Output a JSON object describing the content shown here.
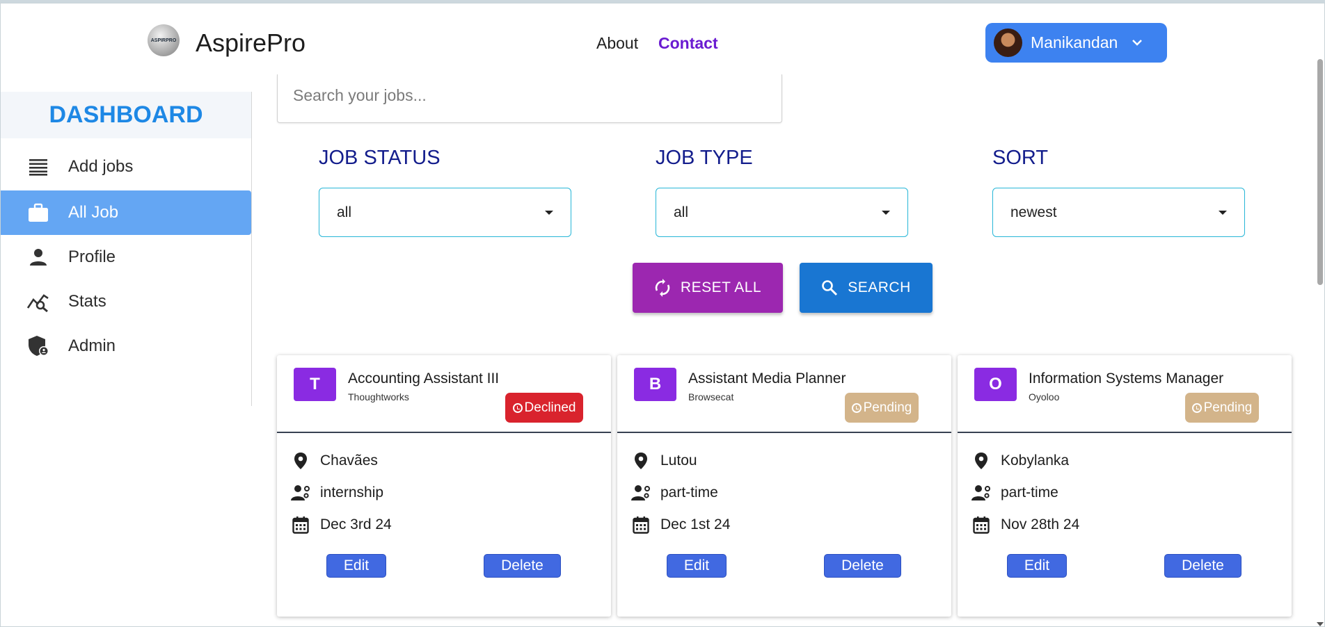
{
  "navbar": {
    "logo_text": "ASPIRPRO",
    "brand": "AspirePro",
    "links": [
      "About",
      "Contact"
    ],
    "user_name": "Manikandan"
  },
  "sidebar": {
    "header": "DASHBOARD",
    "items": [
      {
        "label": "Add jobs",
        "icon": "list-icon"
      },
      {
        "label": "All Job",
        "icon": "briefcase-icon",
        "active": true
      },
      {
        "label": "Profile",
        "icon": "person-icon"
      },
      {
        "label": "Stats",
        "icon": "stats-icon"
      },
      {
        "label": "Admin",
        "icon": "admin-shield-icon"
      }
    ]
  },
  "search": {
    "placeholder": "Search your jobs...",
    "value": ""
  },
  "filters": {
    "job_status": {
      "label": "JOB STATUS",
      "value": "all"
    },
    "job_type": {
      "label": "JOB TYPE",
      "value": "all"
    },
    "sort": {
      "label": "SORT",
      "value": "newest"
    }
  },
  "buttons": {
    "reset": "RESET ALL",
    "search": "SEARCH"
  },
  "jobs": [
    {
      "letter": "T",
      "title": "Accounting Assistant III",
      "company": "Thoughtworks",
      "status": "Declined",
      "location": "Chavães",
      "type": "internship",
      "date": "Dec 3rd 24",
      "edit": "Edit",
      "delete": "Delete"
    },
    {
      "letter": "B",
      "title": "Assistant Media Planner",
      "company": "Browsecat",
      "status": "Pending",
      "location": "Lutou",
      "type": "part-time",
      "date": "Dec 1st 24",
      "edit": "Edit",
      "delete": "Delete"
    },
    {
      "letter": "O",
      "title": "Information Systems Manager",
      "company": "Oyoloo",
      "status": "Pending",
      "location": "Kobylanka",
      "type": "part-time",
      "date": "Nov 28th 24",
      "edit": "Edit",
      "delete": "Delete"
    }
  ],
  "colors": {
    "accent_blue": "#3d82f0",
    "dashboard_blue": "#1e88e5",
    "active_sidebar": "#64a6f3",
    "reset_purple": "#9c27b0",
    "search_blue": "#1976d2",
    "declined_red": "#d9232d",
    "pending_tan": "#d3b48a",
    "letter_purple": "#8a2be2",
    "contact_purple": "#6a1bd1"
  }
}
